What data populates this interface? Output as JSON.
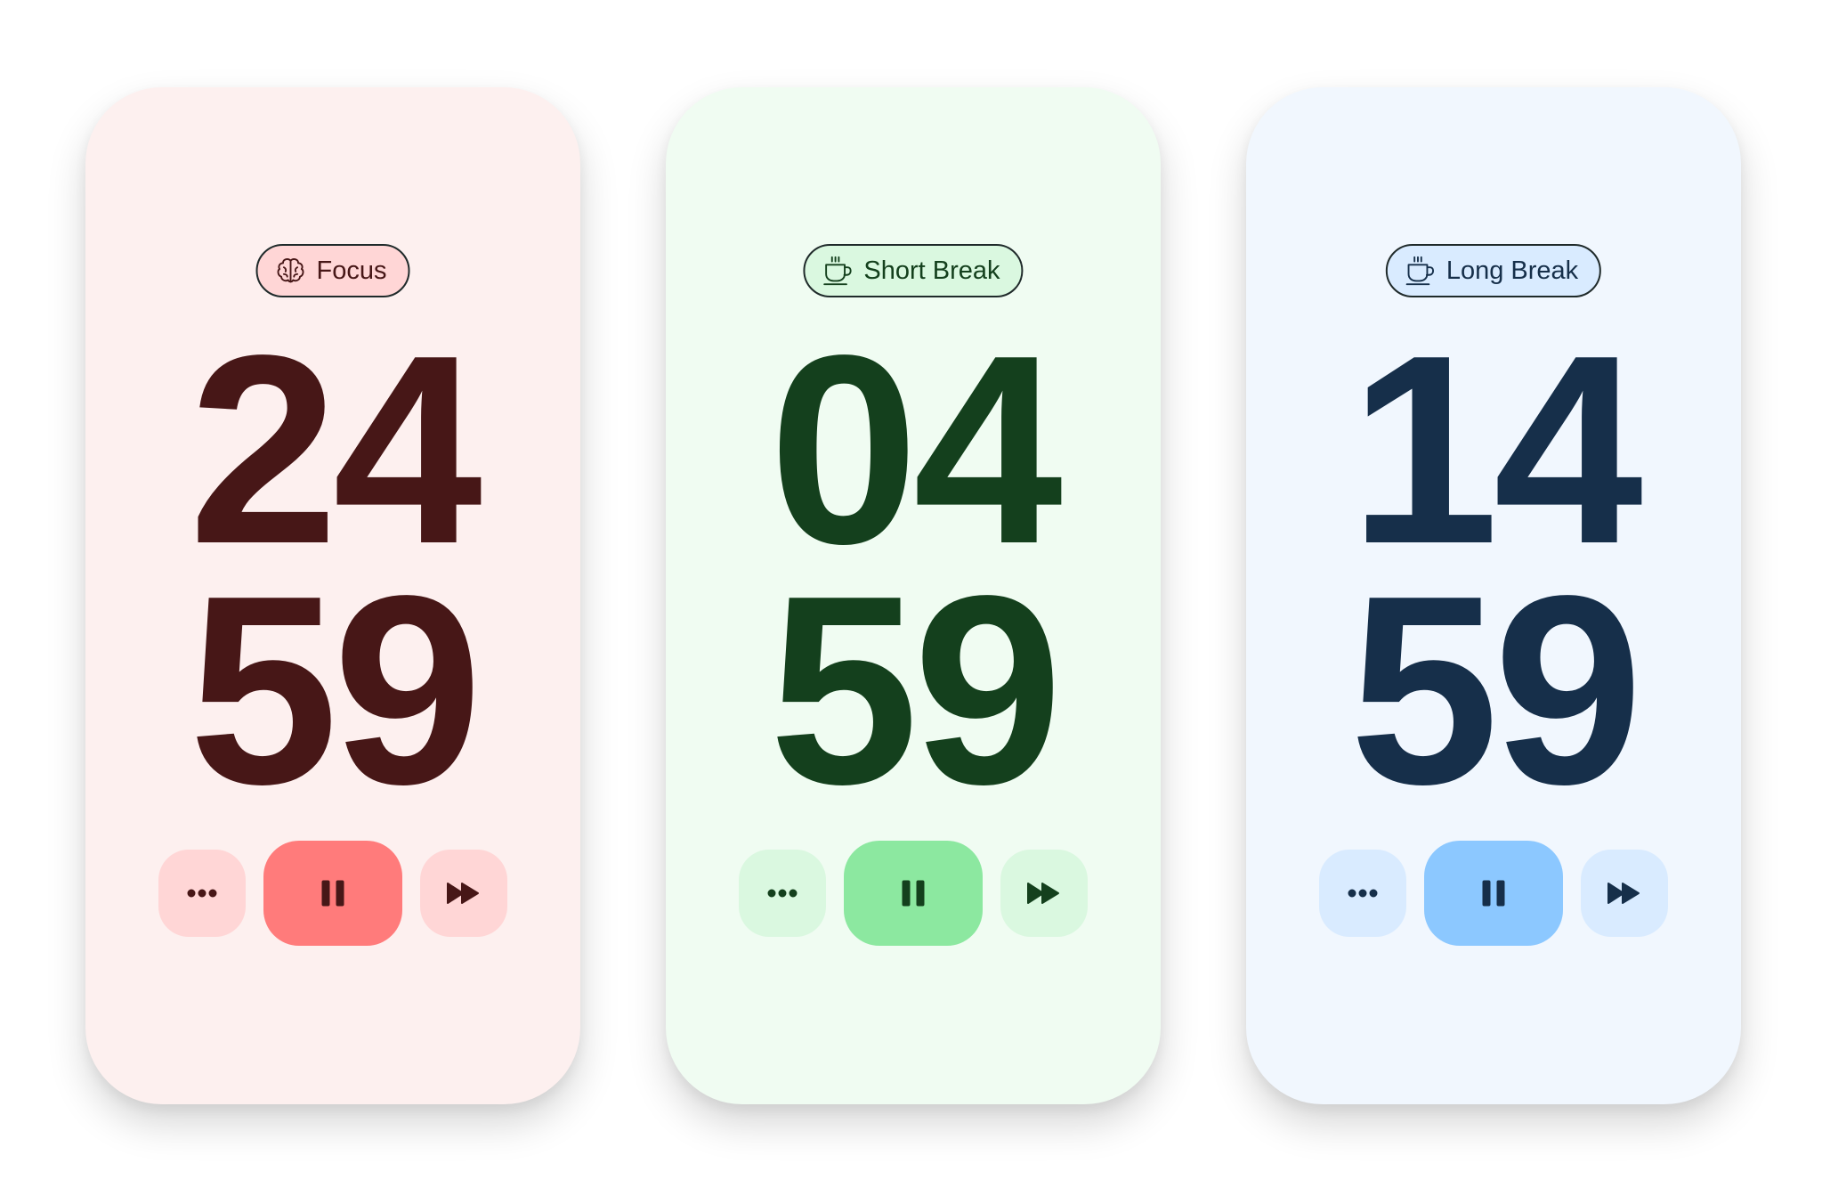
{
  "timers": [
    {
      "mode_label": "Focus",
      "mode_icon": "brain-icon",
      "minutes": "24",
      "seconds": "59",
      "colors": {
        "card_bg": "#fdf0ef",
        "digits": "#471717",
        "chip_bg": "#ffd6d6",
        "chip_text": "#471717",
        "button_bg": "#ffd6d6",
        "primary_bg": "#ff7b7b",
        "icon": "#471717"
      },
      "controls": {
        "more_icon": "more-dots-icon",
        "primary_icon": "pause-icon",
        "skip_icon": "fast-forward-icon"
      }
    },
    {
      "mode_label": "Short Break",
      "mode_icon": "coffee-cup-icon",
      "minutes": "04",
      "seconds": "59",
      "colors": {
        "card_bg": "#f0fcf2",
        "digits": "#14401d",
        "chip_bg": "#daf8e0",
        "chip_text": "#14401d",
        "button_bg": "#daf8e0",
        "primary_bg": "#8ce8a0",
        "icon": "#14401d"
      },
      "controls": {
        "more_icon": "more-dots-icon",
        "primary_icon": "pause-icon",
        "skip_icon": "fast-forward-icon"
      }
    },
    {
      "mode_label": "Long Break",
      "mode_icon": "coffee-cup-icon",
      "minutes": "14",
      "seconds": "59",
      "colors": {
        "card_bg": "#f1f7fe",
        "digits": "#162f4a",
        "chip_bg": "#d9ebff",
        "chip_text": "#162f4a",
        "button_bg": "#d9ebff",
        "primary_bg": "#8cc8ff",
        "icon": "#162f4a"
      },
      "controls": {
        "more_icon": "more-dots-icon",
        "primary_icon": "pause-icon",
        "skip_icon": "fast-forward-icon"
      }
    }
  ]
}
